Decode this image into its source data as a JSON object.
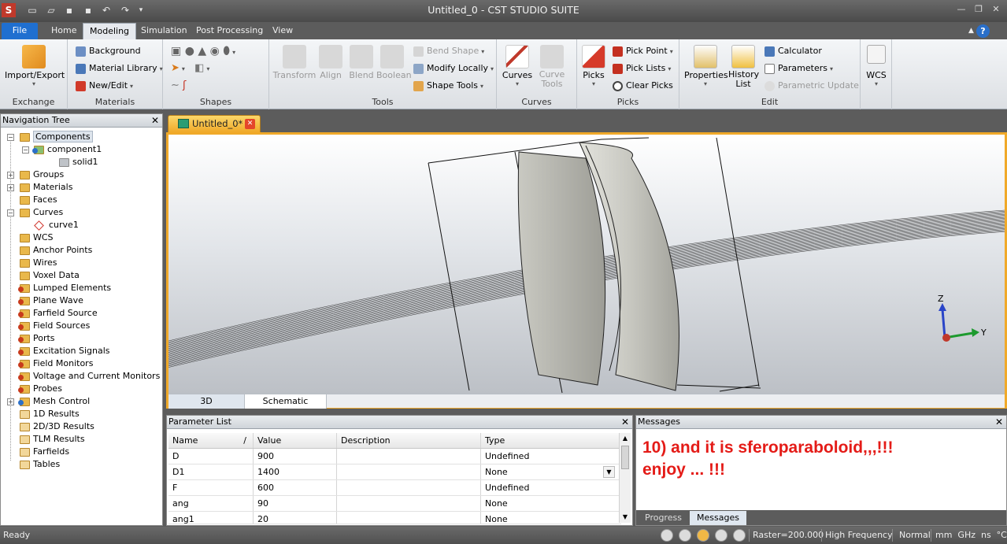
{
  "window": {
    "title": "Untitled_0 - CST STUDIO SUITE"
  },
  "ribbon_tabs": [
    "File",
    "Home",
    "Modeling",
    "Simulation",
    "Post Processing",
    "View"
  ],
  "active_tab": "Modeling",
  "ribbon": {
    "exchange": {
      "label": "Exchange",
      "import_export": "Import/Export"
    },
    "materials": {
      "label": "Materials",
      "background": "Background",
      "material_library": "Material Library",
      "new_edit": "New/Edit"
    },
    "shapes": {
      "label": "Shapes"
    },
    "tools": {
      "label": "Tools",
      "transform": "Transform",
      "align": "Align",
      "blend": "Blend",
      "boolean": "Boolean",
      "bend_shape": "Bend Shape",
      "modify_locally": "Modify Locally",
      "shape_tools": "Shape Tools"
    },
    "curves": {
      "label": "Curves",
      "curves": "Curves",
      "curve_tools_1": "Curve",
      "curve_tools_2": "Tools"
    },
    "picks": {
      "label": "Picks",
      "picks": "Picks",
      "pick_point": "Pick Point",
      "pick_lists": "Pick Lists",
      "clear_picks": "Clear Picks"
    },
    "edit": {
      "label": "Edit",
      "properties": "Properties",
      "history_1": "History",
      "history_2": "List",
      "calculator": "Calculator",
      "parameters": "Parameters",
      "parametric_update": "Parametric Update"
    },
    "wcs": {
      "label": "WCS"
    }
  },
  "nav_tree": {
    "title": "Navigation Tree",
    "items": [
      "Components",
      "component1",
      "solid1",
      "Groups",
      "Materials",
      "Faces",
      "Curves",
      "curve1",
      "WCS",
      "Anchor Points",
      "Wires",
      "Voxel Data",
      "Lumped Elements",
      "Plane Wave",
      "Farfield Source",
      "Field Sources",
      "Ports",
      "Excitation Signals",
      "Field Monitors",
      "Voltage and Current Monitors",
      "Probes",
      "Mesh Control",
      "1D Results",
      "2D/3D Results",
      "TLM Results",
      "Farfields",
      "Tables"
    ]
  },
  "document_tab": "Untitled_0*",
  "view_tabs": [
    "3D",
    "Schematic"
  ],
  "parameter_list": {
    "title": "Parameter List",
    "columns": [
      "Name",
      "Value",
      "Description",
      "Type"
    ],
    "sort_mark": "/",
    "rows": [
      {
        "name": "D",
        "value": "900",
        "description": "",
        "type": "Undefined"
      },
      {
        "name": "D1",
        "value": "1400",
        "description": "",
        "type": "None"
      },
      {
        "name": "F",
        "value": "600",
        "description": "",
        "type": "Undefined"
      },
      {
        "name": "ang",
        "value": "90",
        "description": "",
        "type": "None"
      },
      {
        "name": "ang1",
        "value": "20",
        "description": "",
        "type": "None"
      }
    ]
  },
  "messages": {
    "title": "Messages",
    "line1": "10) and it is sferoparaboloid,,,!!!",
    "line2": "enjoy ... !!!",
    "tabs": [
      "Progress",
      "Messages"
    ]
  },
  "axes": {
    "z": "Z",
    "y": "Y"
  },
  "status": {
    "ready": "Ready",
    "raster": "Raster=200.000",
    "frequency": "High Frequency",
    "mode": "Normal",
    "units": "mm  GHz  ns  °C"
  },
  "colors": {
    "accent": "#f0a929",
    "file_tab": "#1f6fd0",
    "message": "#e41b17"
  }
}
